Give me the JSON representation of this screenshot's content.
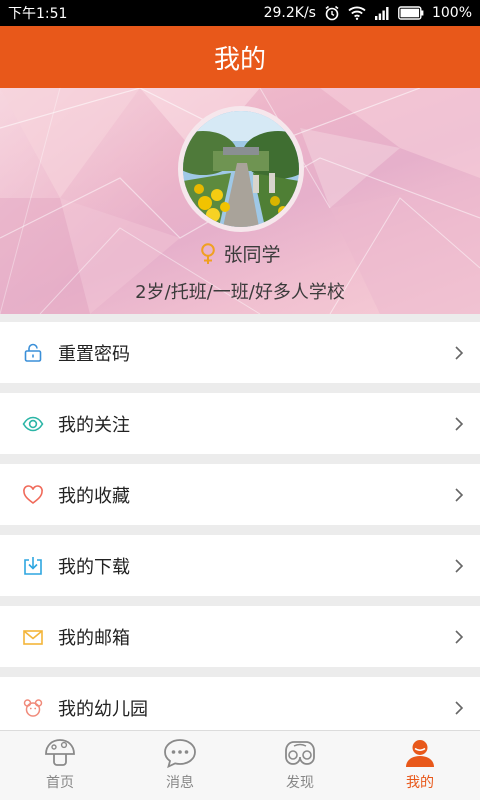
{
  "status_bar": {
    "time": "下午1:51",
    "speed": "29.2K/s",
    "battery": "100%"
  },
  "header": {
    "title": "我的"
  },
  "profile": {
    "name": "张同学",
    "gender_icon": "female-icon",
    "info": "2岁/托班/一班/好多人学校"
  },
  "menu": [
    {
      "label": "重置密码",
      "icon": "lock-icon",
      "color": "#3a8fd8"
    },
    {
      "label": "我的关注",
      "icon": "eye-icon",
      "color": "#2bb5a6"
    },
    {
      "label": "我的收藏",
      "icon": "heart-icon",
      "color": "#f06a5a"
    },
    {
      "label": "我的下载",
      "icon": "download-icon",
      "color": "#2ea6e0"
    },
    {
      "label": "我的邮箱",
      "icon": "mail-icon",
      "color": "#f3b53a"
    },
    {
      "label": "我的幼儿园",
      "icon": "bear-icon",
      "color": "#f08a7a"
    }
  ],
  "tabbar": {
    "tabs": [
      {
        "label": "首页",
        "icon": "mushroom-icon",
        "active": false
      },
      {
        "label": "消息",
        "icon": "chat-bubble-icon",
        "active": false
      },
      {
        "label": "发现",
        "icon": "binoculars-icon",
        "active": false
      },
      {
        "label": "我的",
        "icon": "person-icon",
        "active": true
      }
    ]
  },
  "colors": {
    "accent": "#e8581a",
    "tab_inactive": "#888888"
  }
}
